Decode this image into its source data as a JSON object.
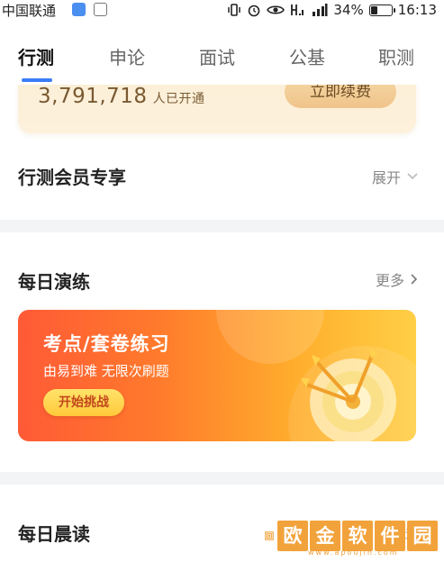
{
  "status_bar": {
    "carrier": "中国联通",
    "battery_text": "34%",
    "battery_level": 0.34,
    "time": "16:13"
  },
  "tabs": [
    {
      "label": "行测",
      "active": true
    },
    {
      "label": "申论",
      "active": false
    },
    {
      "label": "面试",
      "active": false
    },
    {
      "label": "公基",
      "active": false
    },
    {
      "label": "职测",
      "active": false
    }
  ],
  "member_card": {
    "count": "3,791,718",
    "count_suffix": "人已开通",
    "renew_label": "立即续费"
  },
  "member_perks": {
    "title": "行测会员专享",
    "action": "展开"
  },
  "daily_practice": {
    "title": "每日演练",
    "action": "更多",
    "banner": {
      "title": "考点/套卷练习",
      "subtitle": "由易到难  无限次刷题",
      "button": "开始挑战"
    }
  },
  "morning_read": {
    "title": "每日晨读",
    "action": "更多"
  },
  "watermark": {
    "chars": [
      "欧",
      "金",
      "软",
      "件",
      "园"
    ],
    "url": "www.apoujin.com"
  },
  "colors": {
    "accent": "#3b7cf5",
    "banner_start": "#ff5a36",
    "banner_end": "#ffcf45",
    "member_bg": "#fbeed6"
  }
}
